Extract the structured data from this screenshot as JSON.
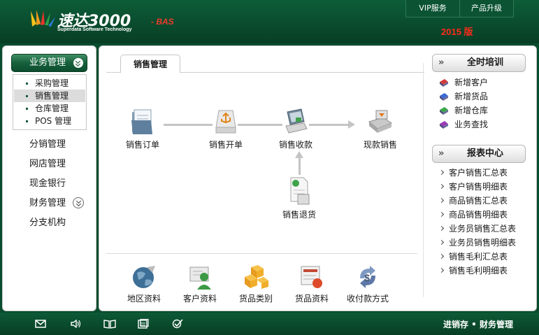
{
  "app": {
    "logo_name": "速达3000",
    "logo_edition": "- BAS",
    "logo_subtitle": "Superdata Software Technology",
    "year_badge": "2015 版",
    "top_links": [
      "VIP服务",
      "产品升级"
    ]
  },
  "sidebar": {
    "active_group": "业务管理",
    "sub_items": [
      {
        "label": "采购管理",
        "active": false
      },
      {
        "label": "销售管理",
        "active": true
      },
      {
        "label": "仓库管理",
        "active": false
      },
      {
        "label": "POS 管理",
        "active": false
      }
    ],
    "items": [
      "分销管理",
      "网店管理",
      "现金银行",
      "财务管理",
      "分支机构"
    ]
  },
  "main": {
    "tab": "销售管理",
    "flow": {
      "order": "销售订单",
      "invoice": "销售开单",
      "collect": "销售收款",
      "cash_sale": "现款销售",
      "return": "销售退货"
    },
    "base_data": [
      "地区资料",
      "客户资料",
      "货品类别",
      "货品资料",
      "收付款方式"
    ]
  },
  "right": {
    "training_title": "全时培训",
    "quick_links": [
      "新增客户",
      "新增货品",
      "新增仓库",
      "业务查找"
    ],
    "reports_title": "报表中心",
    "reports": [
      "客户销售汇总表",
      "客户销售明细表",
      "商品销售汇总表",
      "商品销售明细表",
      "业务员销售汇总表",
      "业务员销售明细表",
      "销售毛利汇总表",
      "销售毛利明细表"
    ]
  },
  "footer": {
    "tagline": "进销存 • 财务管理",
    "icons": [
      "mail-icon",
      "speaker-icon",
      "book-icon",
      "calendar-icon",
      "check-icon"
    ]
  },
  "colors": {
    "header_green": "#0a4c2e",
    "accent_red": "#ff2a1a",
    "flow_gray": "#c4c4c4"
  }
}
